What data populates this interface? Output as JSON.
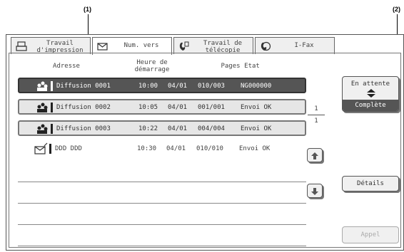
{
  "callouts": {
    "c1": "(1)",
    "c2": "(2)"
  },
  "tabs": [
    {
      "label": "Travail d'impression",
      "icon": "printer-icon"
    },
    {
      "label": "Num. vers",
      "icon": "envelope-icon"
    },
    {
      "label": "Travail de télécopie",
      "icon": "fax-icon"
    },
    {
      "label": "I-Fax",
      "icon": "internet-fax-icon"
    }
  ],
  "headers": {
    "address": "Adresse",
    "start_time": "Heure de démarrage",
    "pages": "Pages",
    "status": "Etat"
  },
  "jobs": [
    {
      "address": "Diffusion 0001",
      "time": "10:00",
      "date": "04/01",
      "pages": "010/003",
      "status": "NG000000",
      "icon": "broadcast-icon"
    },
    {
      "address": "Diffusion 0002",
      "time": "10:05",
      "date": "04/01",
      "pages": "001/001",
      "status": "Envoi OK",
      "icon": "broadcast-icon"
    },
    {
      "address": "Diffusion 0003",
      "time": "10:22",
      "date": "04/01",
      "pages": "004/004",
      "status": "Envoi OK",
      "icon": "broadcast-icon"
    },
    {
      "address": "DDD DDD",
      "time": "10:30",
      "date": "04/01",
      "pages": "010/010",
      "status": "Envoi OK",
      "icon": "email-send-icon"
    }
  ],
  "pagination": {
    "current": "1",
    "total": "1"
  },
  "buttons": {
    "queue_top": "En attente",
    "queue_bottom": "Complète",
    "details": "Détails",
    "call": "Appel"
  }
}
